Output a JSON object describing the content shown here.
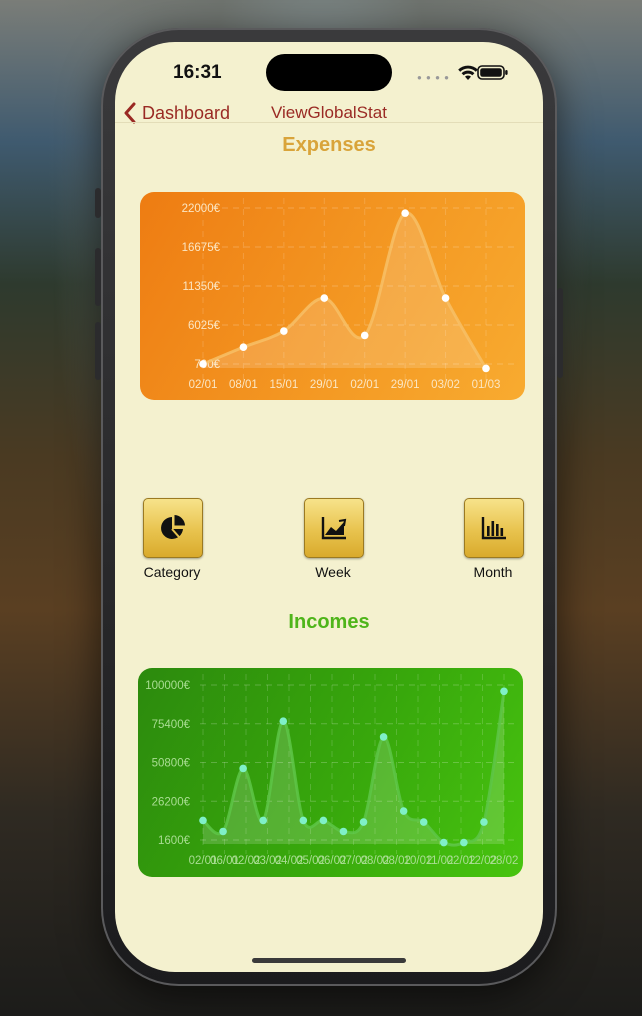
{
  "status_bar": {
    "time": "16:31"
  },
  "nav": {
    "back_label": "Dashboard",
    "title": "ViewGlobalStat"
  },
  "expenses": {
    "title": "Expenses",
    "title_color": "#d9a43a"
  },
  "incomes": {
    "title": "Incomes",
    "title_color": "#4fb51a"
  },
  "category_buttons": [
    {
      "label": "Category",
      "icon": "pie-chart-icon"
    },
    {
      "label": "Week",
      "icon": "line-chart-icon"
    },
    {
      "label": "Month",
      "icon": "bar-chart-icon"
    }
  ],
  "chart_data": [
    {
      "type": "area",
      "name": "expenses",
      "colors": {
        "bg_start": "#ef7e14",
        "bg_end": "#f6a52c",
        "line": "#f7c066",
        "point": "#ffffff",
        "text": "#fbe6c3"
      },
      "y_ticks": [
        "22000€",
        "16675€",
        "11350€",
        "6025€",
        "700€"
      ],
      "y_tick_values": [
        22000,
        16675,
        11350,
        6025,
        700
      ],
      "ylim": [
        700,
        22000
      ],
      "x_labels": [
        "02/01",
        "08/01",
        "15/01",
        "29/01",
        "02/01",
        "29/01",
        "03/02",
        "01/03"
      ],
      "points": [
        {
          "x": 0,
          "y": 700
        },
        {
          "x": 1,
          "y": 3000
        },
        {
          "x": 2,
          "y": 5200
        },
        {
          "x": 3,
          "y": 9700
        },
        {
          "x": 4,
          "y": 4600
        },
        {
          "x": 5,
          "y": 21300
        },
        {
          "x": 6,
          "y": 9700
        },
        {
          "x": 7,
          "y": 100
        }
      ],
      "grid": true
    },
    {
      "type": "area",
      "name": "incomes",
      "colors": {
        "bg_start": "#2f8e0e",
        "bg_end": "#45c20d",
        "line": "#5ec548",
        "point": "#7ff0c8",
        "text": "#a9dd93"
      },
      "y_ticks": [
        "100000€",
        "75400€",
        "50800€",
        "26200€",
        "1600€"
      ],
      "y_tick_values": [
        100000,
        75400,
        50800,
        26200,
        1600
      ],
      "ylim": [
        1600,
        100000
      ],
      "x_labels": [
        "02/01",
        "06/01",
        "02/02",
        "03/02",
        "04/02",
        "05/02",
        "06/02",
        "07/02",
        "08/02",
        "08/02",
        "10/02",
        "11/02",
        "02/02",
        "12/02",
        "28/02"
      ],
      "points": [
        {
          "x": 0,
          "y": 14000
        },
        {
          "x": 1,
          "y": 7000
        },
        {
          "x": 2,
          "y": 47000
        },
        {
          "x": 3,
          "y": 14000
        },
        {
          "x": 4,
          "y": 77000
        },
        {
          "x": 5,
          "y": 14000
        },
        {
          "x": 6,
          "y": 14000
        },
        {
          "x": 7,
          "y": 7000
        },
        {
          "x": 8,
          "y": 13000
        },
        {
          "x": 9,
          "y": 67000
        },
        {
          "x": 10,
          "y": 20000
        },
        {
          "x": 11,
          "y": 13000
        },
        {
          "x": 12,
          "y": 0
        },
        {
          "x": 13,
          "y": 0
        },
        {
          "x": 14,
          "y": 13000
        },
        {
          "x": 15,
          "y": 96000
        }
      ],
      "grid": true
    }
  ]
}
